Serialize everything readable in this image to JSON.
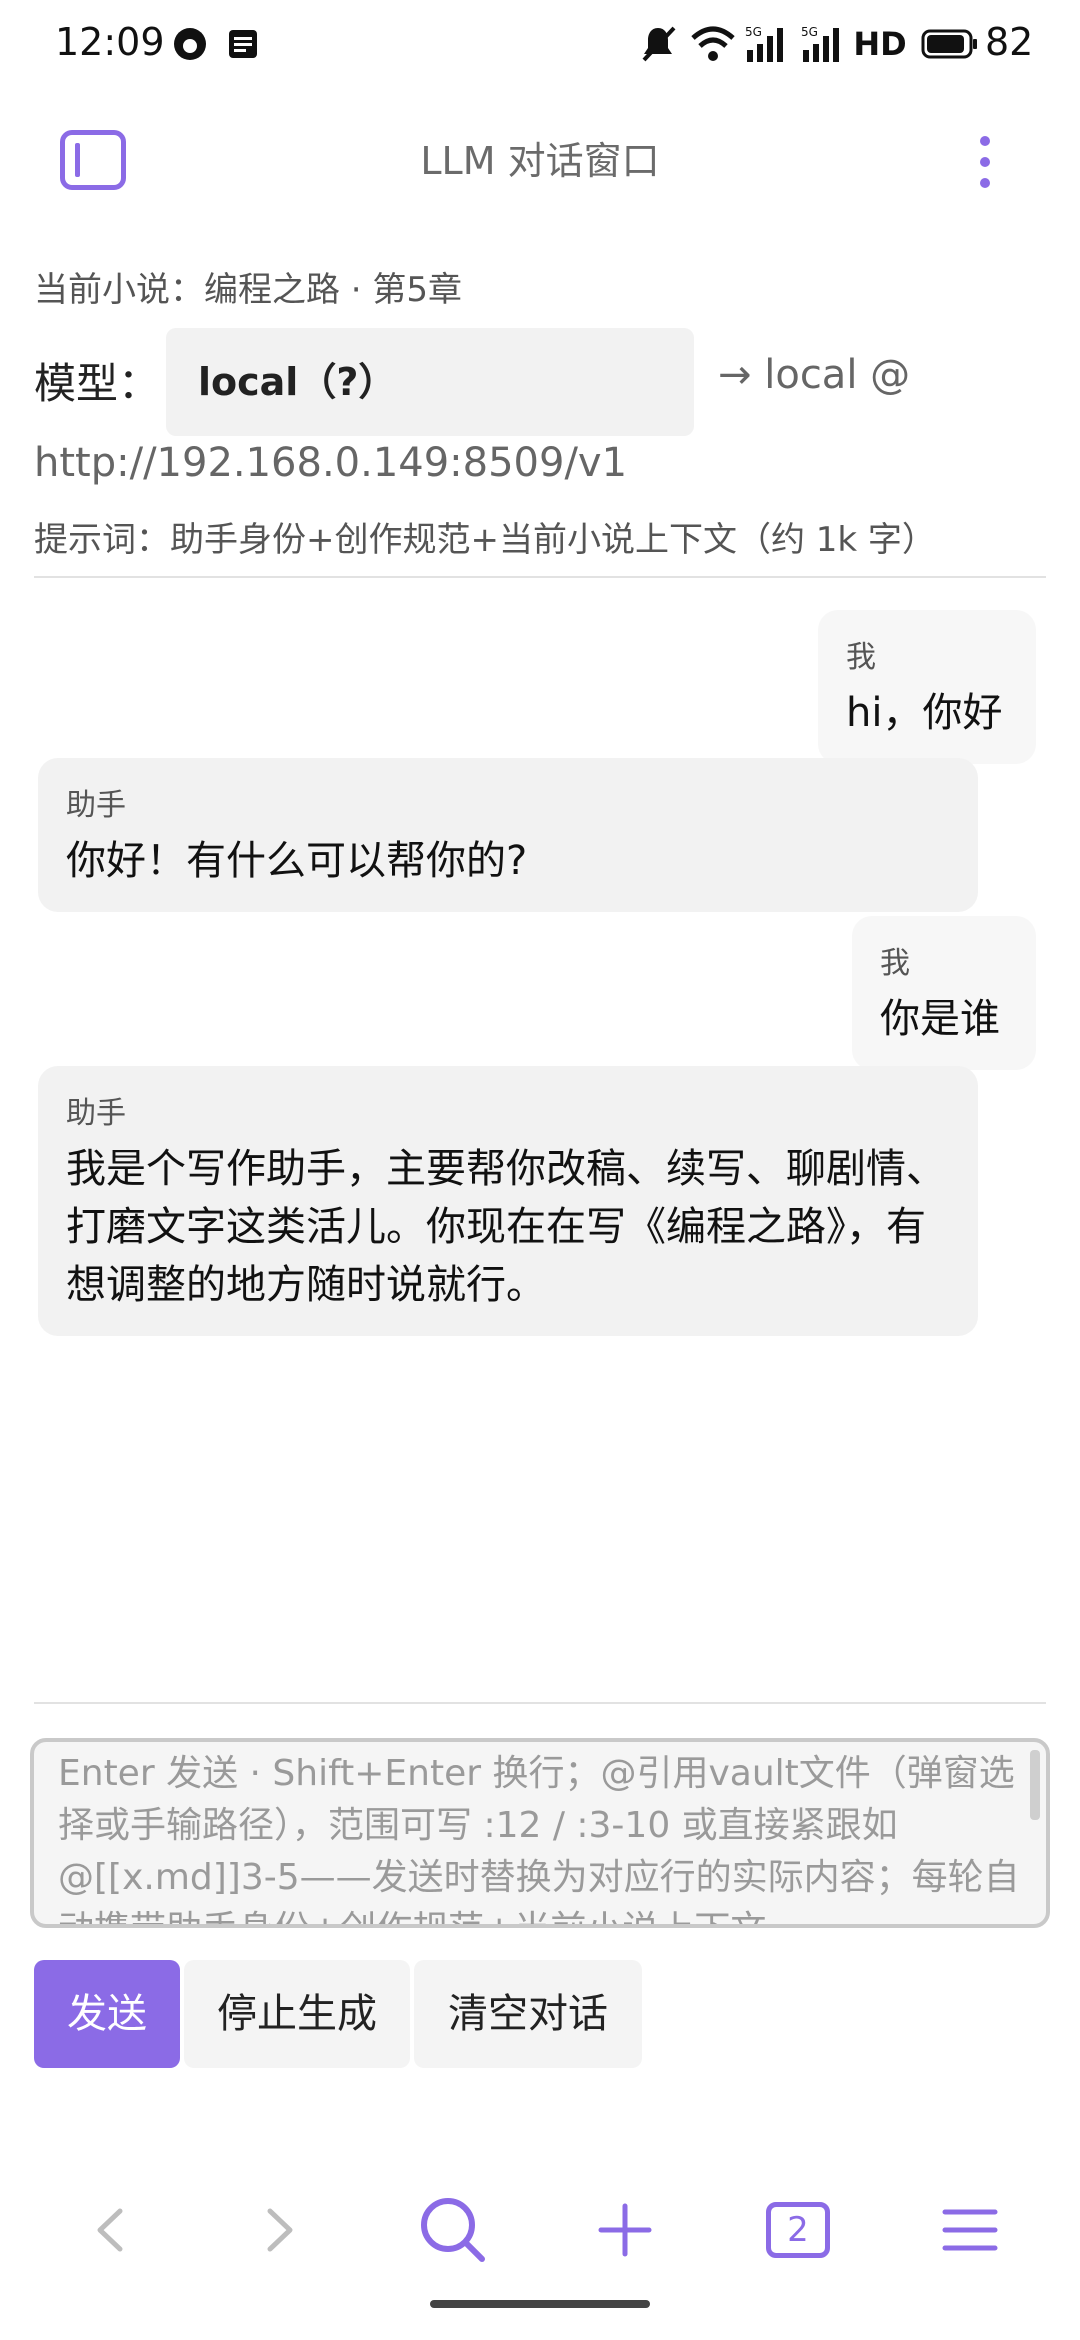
{
  "status_bar": {
    "time": "12:09",
    "battery_level": "82",
    "network": "5G",
    "hd_label": "HD"
  },
  "header": {
    "title": "LLM 对话窗口"
  },
  "info": {
    "current_novel": "当前小说：编程之路 · 第5章",
    "model_label": "模型：",
    "model_value": "local（?）",
    "model_arrow_text": "→ local @",
    "model_url": "http://192.168.0.149:8509/v1",
    "prompt_info": "提示词：助手身份+创作规范+当前小说上下文（约 1k 字）"
  },
  "messages": [
    {
      "role": "我",
      "text": "hi，你好"
    },
    {
      "role": "助手",
      "text": "你好！有什么可以帮你的?"
    },
    {
      "role": "我",
      "text": "你是谁"
    },
    {
      "role": "助手",
      "text": "我是个写作助手，主要帮你改稿、续写、聊剧情、打磨文字这类活儿。你现在在写《编程之路》，有想调整的地方随时说就行。"
    }
  ],
  "composer": {
    "placeholder": "Enter 发送 · Shift+Enter 换行；@引用vault文件（弹窗选择或手输路径），范围可写 :12 / :3-10 或直接紧跟如 @[[x.md]]3-5——发送时替换为对应行的实际内容；每轮自动携带助手身份+创作规范+当前小说上下文",
    "value": ""
  },
  "buttons": {
    "send": "发送",
    "stop": "停止生成",
    "clear": "清空对话"
  },
  "bottom_nav": {
    "tab_count": "2"
  },
  "colors": {
    "accent": "#8b6be6",
    "bubble_bg": "#f2f2f2"
  }
}
